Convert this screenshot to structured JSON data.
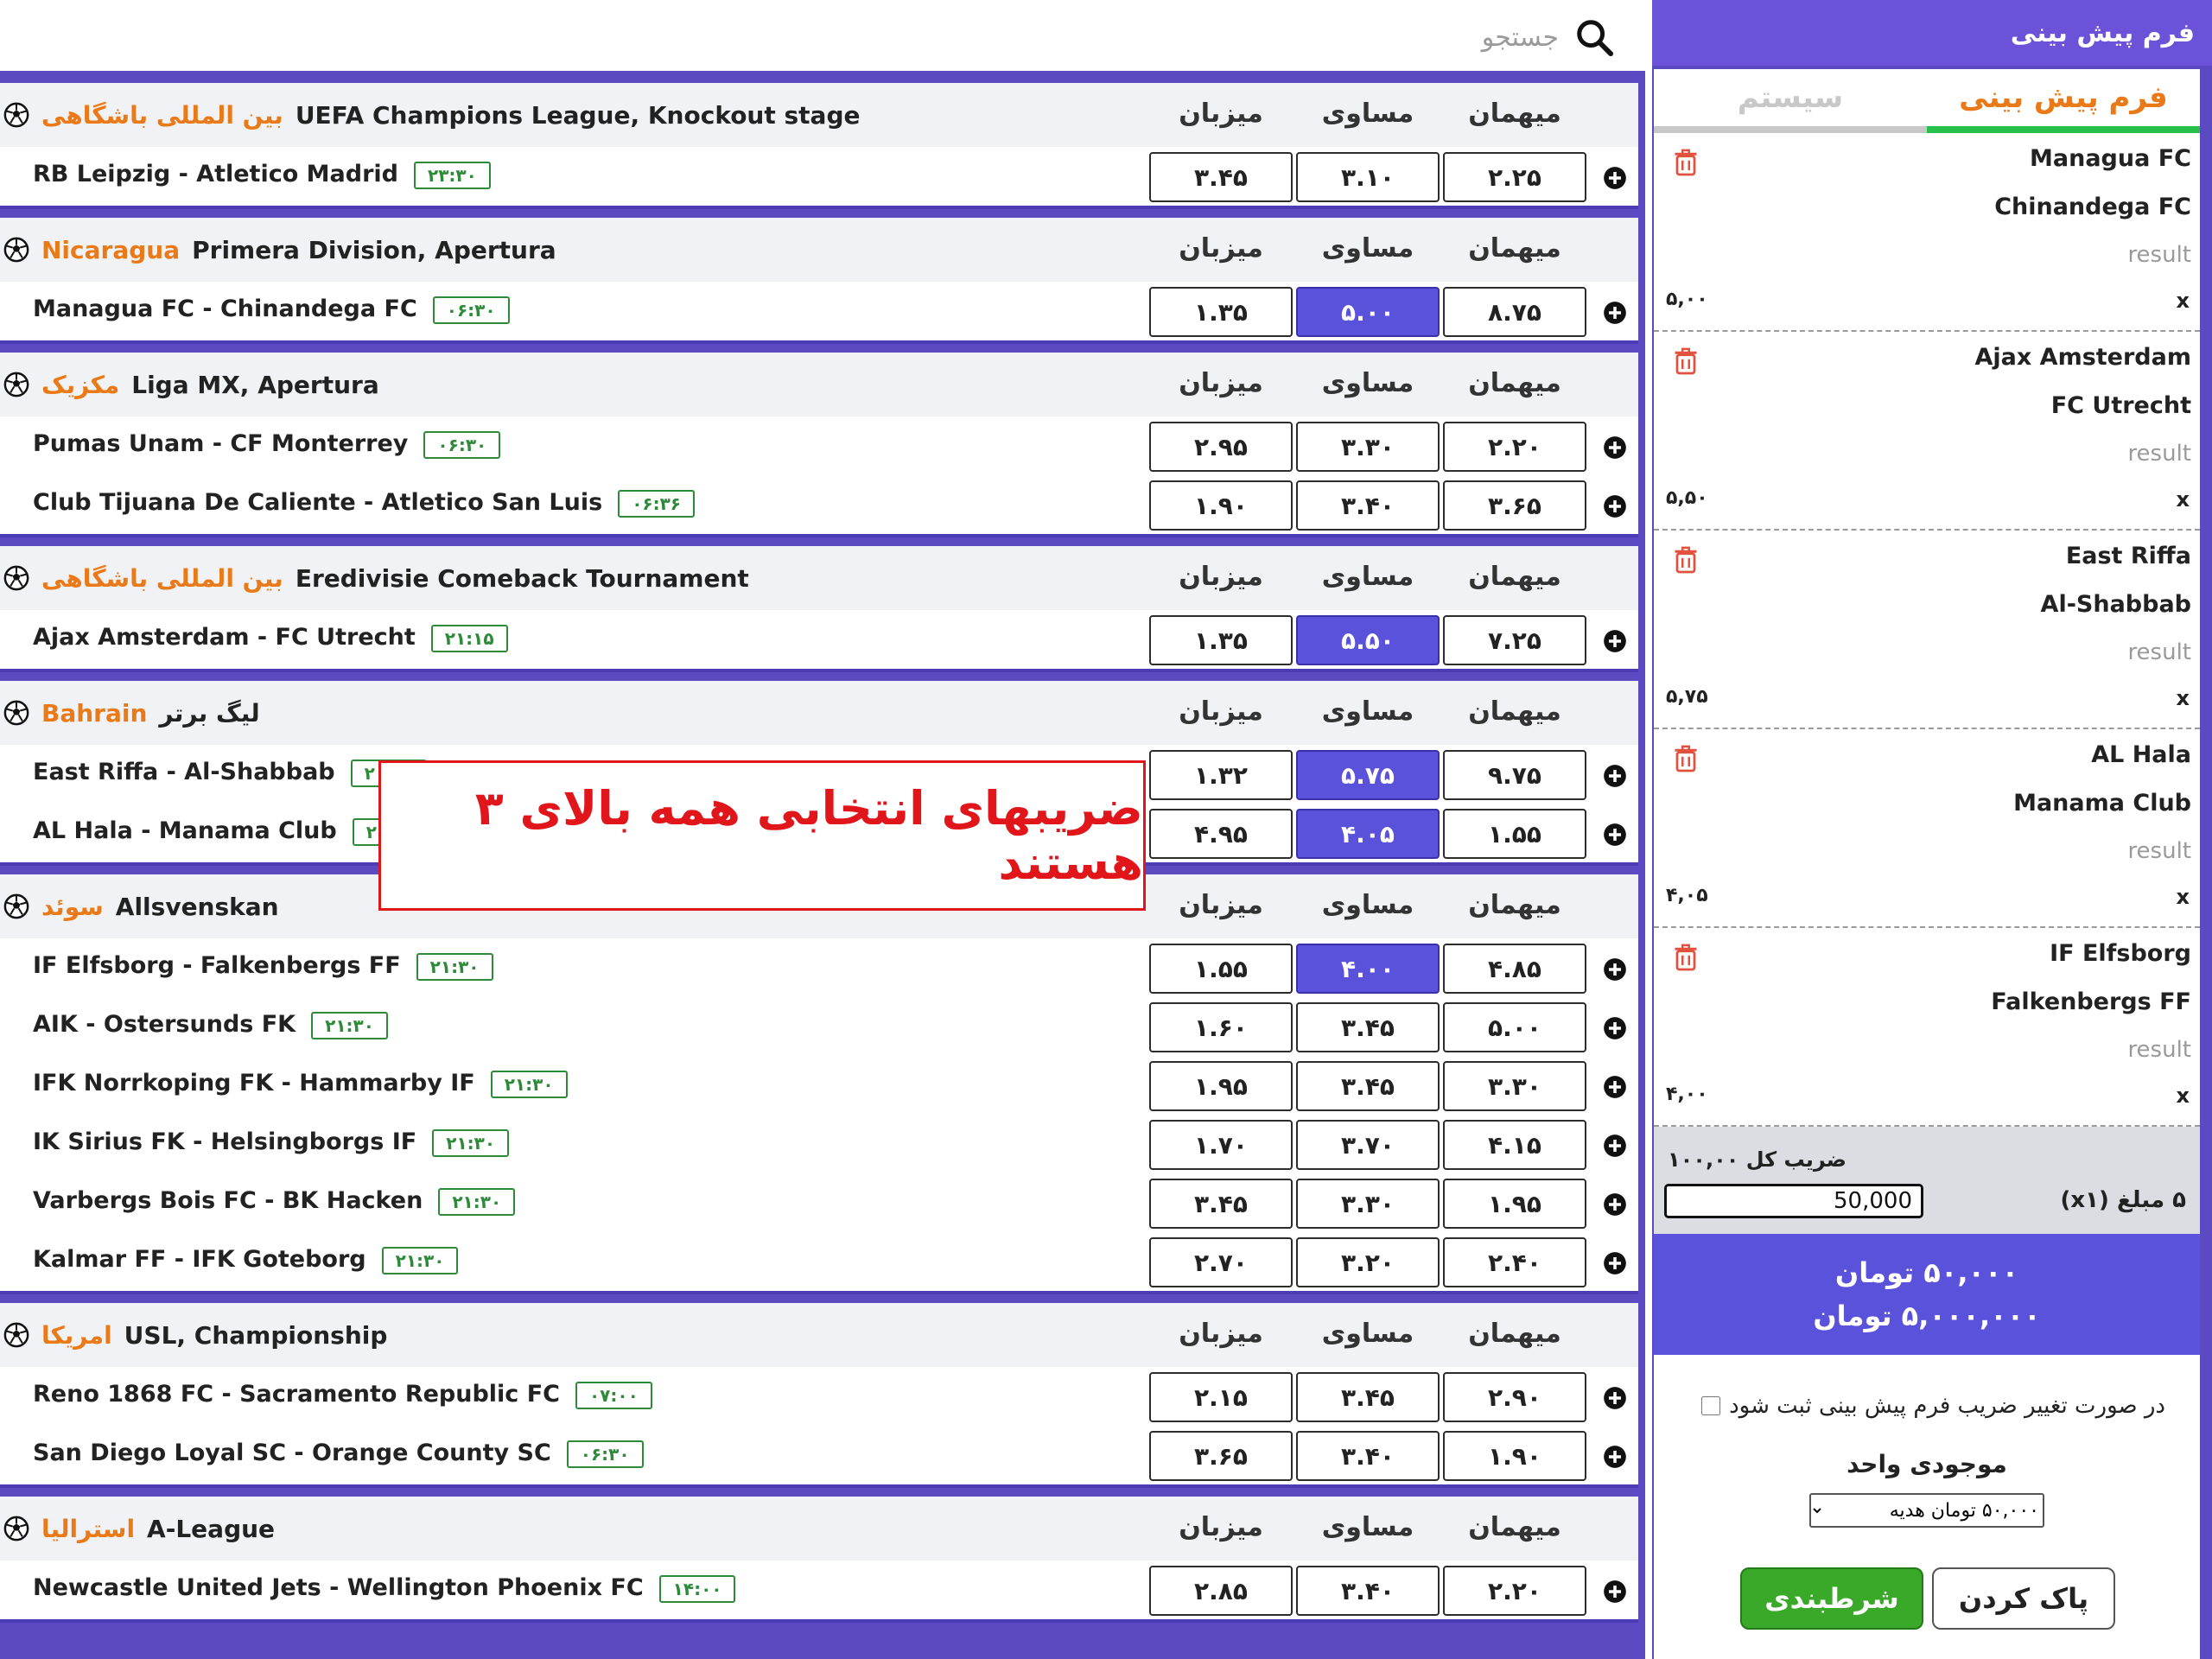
{
  "search": {
    "placeholder": "جستجو",
    "icon": "search-icon"
  },
  "columns": {
    "home": "میزبان",
    "draw": "مساوی",
    "away": "میهمان"
  },
  "leagues": [
    {
      "country": "بین المللی باشگاهی",
      "name": "UEFA Champions League, Knockout stage",
      "matches": [
        {
          "teams": "RB Leipzig  -  Atletico Madrid",
          "time": "۲۳:۳۰",
          "home": "۳.۴۵",
          "draw": "۳.۱۰",
          "away": "۲.۲۵",
          "selected": ""
        }
      ]
    },
    {
      "country": "Nicaragua",
      "name": "Primera Division, Apertura",
      "matches": [
        {
          "teams": "Managua FC  -  Chinandega FC",
          "time": "۰۶:۳۰",
          "home": "۱.۳۵",
          "draw": "۵.۰۰",
          "away": "۸.۷۵",
          "selected": "draw"
        }
      ]
    },
    {
      "country": "مکزیک",
      "name": "Liga MX, Apertura",
      "matches": [
        {
          "teams": "Pumas Unam  -  CF Monterrey",
          "time": "۰۶:۳۰",
          "home": "۲.۹۵",
          "draw": "۳.۳۰",
          "away": "۲.۲۰",
          "selected": ""
        },
        {
          "teams": "Club Tijuana De Caliente  -  Atletico San Luis",
          "time": "۰۶:۳۶",
          "home": "۱.۹۰",
          "draw": "۳.۴۰",
          "away": "۳.۶۵",
          "selected": ""
        }
      ]
    },
    {
      "country": "بین المللی باشگاهی",
      "name": "Eredivisie Comeback Tournament",
      "matches": [
        {
          "teams": "Ajax Amsterdam  -  FC Utrecht",
          "time": "۲۱:۱۵",
          "home": "۱.۳۵",
          "draw": "۵.۵۰",
          "away": "۷.۲۵",
          "selected": "draw"
        }
      ]
    },
    {
      "country": "Bahrain",
      "name": "لیگ برتر",
      "matches": [
        {
          "teams": "East Riffa  -  Al-Shabbab",
          "time": "۲۰:۳۰",
          "home": "۱.۳۲",
          "draw": "۵.۷۵",
          "away": "۹.۷۵",
          "selected": "draw"
        },
        {
          "teams": "AL Hala  -  Manama Club",
          "time": "۲۰:۳۰",
          "home": "۴.۹۵",
          "draw": "۴.۰۵",
          "away": "۱.۵۵",
          "selected": "draw"
        }
      ]
    },
    {
      "country": "سوئد",
      "name": "Allsvenskan",
      "matches": [
        {
          "teams": "IF Elfsborg  -  Falkenbergs FF",
          "time": "۲۱:۳۰",
          "home": "۱.۵۵",
          "draw": "۴.۰۰",
          "away": "۴.۸۵",
          "selected": "draw"
        },
        {
          "teams": "AIK  -  Ostersunds FK",
          "time": "۲۱:۳۰",
          "home": "۱.۶۰",
          "draw": "۳.۴۵",
          "away": "۵.۰۰",
          "selected": ""
        },
        {
          "teams": "IFK Norrkoping FK  -  Hammarby IF",
          "time": "۲۱:۳۰",
          "home": "۱.۹۵",
          "draw": "۳.۴۵",
          "away": "۳.۳۰",
          "selected": ""
        },
        {
          "teams": "IK Sirius FK  -  Helsingborgs IF",
          "time": "۲۱:۳۰",
          "home": "۱.۷۰",
          "draw": "۳.۷۰",
          "away": "۴.۱۵",
          "selected": ""
        },
        {
          "teams": "Varbergs Bois FC  -  BK Hacken",
          "time": "۲۱:۳۰",
          "home": "۳.۴۵",
          "draw": "۳.۳۰",
          "away": "۱.۹۵",
          "selected": ""
        },
        {
          "teams": "Kalmar FF  -  IFK Goteborg",
          "time": "۲۱:۳۰",
          "home": "۲.۷۰",
          "draw": "۳.۲۰",
          "away": "۲.۴۰",
          "selected": ""
        }
      ]
    },
    {
      "country": "امریکا",
      "name": "USL, Championship",
      "matches": [
        {
          "teams": "Reno 1868 FC  -  Sacramento Republic FC",
          "time": "۰۷:۰۰",
          "home": "۲.۱۵",
          "draw": "۳.۴۵",
          "away": "۲.۹۰",
          "selected": ""
        },
        {
          "teams": "San Diego Loyal SC  -  Orange County SC",
          "time": "۰۶:۳۰",
          "home": "۳.۶۵",
          "draw": "۳.۴۰",
          "away": "۱.۹۰",
          "selected": ""
        }
      ]
    },
    {
      "country": "استرالیا",
      "name": "A-League",
      "matches": [
        {
          "teams": "Newcastle United Jets  -  Wellington Phoenix FC",
          "time": "۱۴:۰۰",
          "home": "۲.۸۵",
          "draw": "۳.۴۰",
          "away": "۲.۲۰",
          "selected": ""
        }
      ]
    }
  ],
  "annotation": {
    "text": "ضریبهای انتخابی همه بالای ۳ هستند",
    "color": "#e0161b"
  },
  "slip": {
    "title": "فرم پیش بینی",
    "tabs": {
      "active": "فرم پیش بینی",
      "inactive": "سیستم"
    },
    "result_label": "result",
    "pick_label": "x",
    "bets": [
      {
        "team1": "Managua FC",
        "team2": "Chinandega FC",
        "odd": "۵,۰۰"
      },
      {
        "team1": "Ajax Amsterdam",
        "team2": "FC Utrecht",
        "odd": "۵,۵۰"
      },
      {
        "team1": "East Riffa",
        "team2": "Al-Shabbab",
        "odd": "۵,۷۵"
      },
      {
        "team1": "AL Hala",
        "team2": "Manama Club",
        "odd": "۴,۰۵"
      },
      {
        "team1": "IF Elfsborg",
        "team2": "Falkenbergs FF",
        "odd": "۴,۰۰"
      }
    ],
    "total_odd": "ضریب کل ۱۰۰,۰۰",
    "stake_value": "50,000",
    "stake_label": "۵ مبلغ (x۱)",
    "total_stake": "۵۰,۰۰۰ تومان",
    "potential_win": "۵,۰۰۰,۰۰۰ تومان",
    "accept_change_label": "در صورت تغییر ضریب فرم پیش بینی ثبت شود",
    "balance_label": "موجودی واحد",
    "wallet_option": "۵۰,۰۰۰ تومان هدیه",
    "submit_label": "شرطبندی",
    "clear_label": "پاک کردن"
  },
  "colors": {
    "accent_purple": "#5b4ac2",
    "selected_odd": "#5b52db",
    "country_orange": "#ea7a18",
    "submit_green": "#3aa829",
    "active_tab_underline": "#27c04a"
  }
}
